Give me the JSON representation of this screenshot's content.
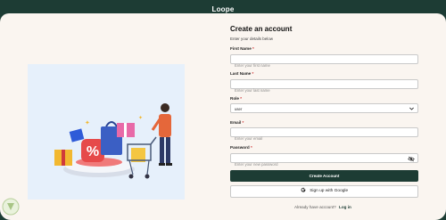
{
  "header": {
    "title": "Loope"
  },
  "form": {
    "title": "Create an account",
    "subtitle": "Enter your details below",
    "first_name": {
      "label": "First Name",
      "placeholder": "Enter your first name"
    },
    "last_name": {
      "label": "Last Name",
      "placeholder": "Enter your last name"
    },
    "role": {
      "label": "Role",
      "value": "user"
    },
    "email": {
      "label": "Email",
      "placeholder": "Enter your email"
    },
    "password": {
      "label": "Password",
      "placeholder": "Enter your new password"
    },
    "required_mark": "*",
    "create_button": "Create Account",
    "google_button": "Sign up with Google",
    "footer_text": "Already have account?",
    "login_link": "Log in"
  },
  "icons": {
    "chevron": "chevron-down-icon",
    "eye": "eye-off-icon",
    "google": "google-icon"
  },
  "colors": {
    "brand": "#1d3c34",
    "page_bg": "#faf5f0",
    "illustration_bg": "#e6f0fb",
    "required": "#d03030"
  }
}
